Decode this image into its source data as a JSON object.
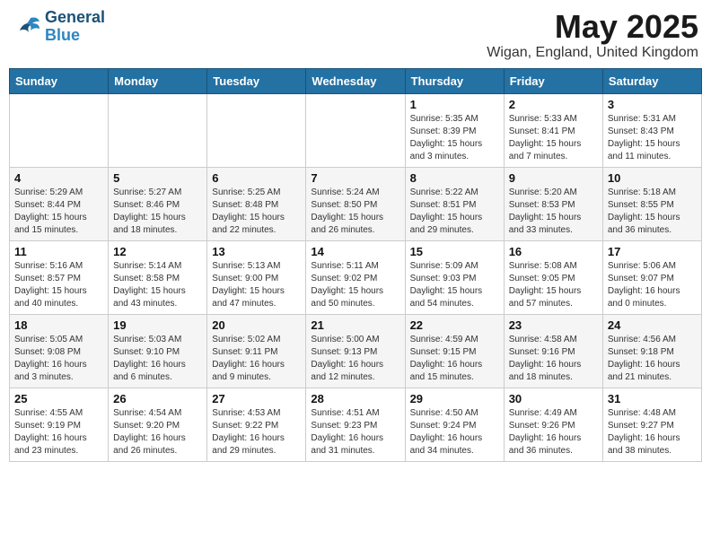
{
  "logo": {
    "line1": "General",
    "line2": "Blue"
  },
  "title": "May 2025",
  "subtitle": "Wigan, England, United Kingdom",
  "days_of_week": [
    "Sunday",
    "Monday",
    "Tuesday",
    "Wednesday",
    "Thursday",
    "Friday",
    "Saturday"
  ],
  "weeks": [
    [
      {
        "day": "",
        "info": ""
      },
      {
        "day": "",
        "info": ""
      },
      {
        "day": "",
        "info": ""
      },
      {
        "day": "",
        "info": ""
      },
      {
        "day": "1",
        "info": "Sunrise: 5:35 AM\nSunset: 8:39 PM\nDaylight: 15 hours\nand 3 minutes."
      },
      {
        "day": "2",
        "info": "Sunrise: 5:33 AM\nSunset: 8:41 PM\nDaylight: 15 hours\nand 7 minutes."
      },
      {
        "day": "3",
        "info": "Sunrise: 5:31 AM\nSunset: 8:43 PM\nDaylight: 15 hours\nand 11 minutes."
      }
    ],
    [
      {
        "day": "4",
        "info": "Sunrise: 5:29 AM\nSunset: 8:44 PM\nDaylight: 15 hours\nand 15 minutes."
      },
      {
        "day": "5",
        "info": "Sunrise: 5:27 AM\nSunset: 8:46 PM\nDaylight: 15 hours\nand 18 minutes."
      },
      {
        "day": "6",
        "info": "Sunrise: 5:25 AM\nSunset: 8:48 PM\nDaylight: 15 hours\nand 22 minutes."
      },
      {
        "day": "7",
        "info": "Sunrise: 5:24 AM\nSunset: 8:50 PM\nDaylight: 15 hours\nand 26 minutes."
      },
      {
        "day": "8",
        "info": "Sunrise: 5:22 AM\nSunset: 8:51 PM\nDaylight: 15 hours\nand 29 minutes."
      },
      {
        "day": "9",
        "info": "Sunrise: 5:20 AM\nSunset: 8:53 PM\nDaylight: 15 hours\nand 33 minutes."
      },
      {
        "day": "10",
        "info": "Sunrise: 5:18 AM\nSunset: 8:55 PM\nDaylight: 15 hours\nand 36 minutes."
      }
    ],
    [
      {
        "day": "11",
        "info": "Sunrise: 5:16 AM\nSunset: 8:57 PM\nDaylight: 15 hours\nand 40 minutes."
      },
      {
        "day": "12",
        "info": "Sunrise: 5:14 AM\nSunset: 8:58 PM\nDaylight: 15 hours\nand 43 minutes."
      },
      {
        "day": "13",
        "info": "Sunrise: 5:13 AM\nSunset: 9:00 PM\nDaylight: 15 hours\nand 47 minutes."
      },
      {
        "day": "14",
        "info": "Sunrise: 5:11 AM\nSunset: 9:02 PM\nDaylight: 15 hours\nand 50 minutes."
      },
      {
        "day": "15",
        "info": "Sunrise: 5:09 AM\nSunset: 9:03 PM\nDaylight: 15 hours\nand 54 minutes."
      },
      {
        "day": "16",
        "info": "Sunrise: 5:08 AM\nSunset: 9:05 PM\nDaylight: 15 hours\nand 57 minutes."
      },
      {
        "day": "17",
        "info": "Sunrise: 5:06 AM\nSunset: 9:07 PM\nDaylight: 16 hours\nand 0 minutes."
      }
    ],
    [
      {
        "day": "18",
        "info": "Sunrise: 5:05 AM\nSunset: 9:08 PM\nDaylight: 16 hours\nand 3 minutes."
      },
      {
        "day": "19",
        "info": "Sunrise: 5:03 AM\nSunset: 9:10 PM\nDaylight: 16 hours\nand 6 minutes."
      },
      {
        "day": "20",
        "info": "Sunrise: 5:02 AM\nSunset: 9:11 PM\nDaylight: 16 hours\nand 9 minutes."
      },
      {
        "day": "21",
        "info": "Sunrise: 5:00 AM\nSunset: 9:13 PM\nDaylight: 16 hours\nand 12 minutes."
      },
      {
        "day": "22",
        "info": "Sunrise: 4:59 AM\nSunset: 9:15 PM\nDaylight: 16 hours\nand 15 minutes."
      },
      {
        "day": "23",
        "info": "Sunrise: 4:58 AM\nSunset: 9:16 PM\nDaylight: 16 hours\nand 18 minutes."
      },
      {
        "day": "24",
        "info": "Sunrise: 4:56 AM\nSunset: 9:18 PM\nDaylight: 16 hours\nand 21 minutes."
      }
    ],
    [
      {
        "day": "25",
        "info": "Sunrise: 4:55 AM\nSunset: 9:19 PM\nDaylight: 16 hours\nand 23 minutes."
      },
      {
        "day": "26",
        "info": "Sunrise: 4:54 AM\nSunset: 9:20 PM\nDaylight: 16 hours\nand 26 minutes."
      },
      {
        "day": "27",
        "info": "Sunrise: 4:53 AM\nSunset: 9:22 PM\nDaylight: 16 hours\nand 29 minutes."
      },
      {
        "day": "28",
        "info": "Sunrise: 4:51 AM\nSunset: 9:23 PM\nDaylight: 16 hours\nand 31 minutes."
      },
      {
        "day": "29",
        "info": "Sunrise: 4:50 AM\nSunset: 9:24 PM\nDaylight: 16 hours\nand 34 minutes."
      },
      {
        "day": "30",
        "info": "Sunrise: 4:49 AM\nSunset: 9:26 PM\nDaylight: 16 hours\nand 36 minutes."
      },
      {
        "day": "31",
        "info": "Sunrise: 4:48 AM\nSunset: 9:27 PM\nDaylight: 16 hours\nand 38 minutes."
      }
    ]
  ]
}
